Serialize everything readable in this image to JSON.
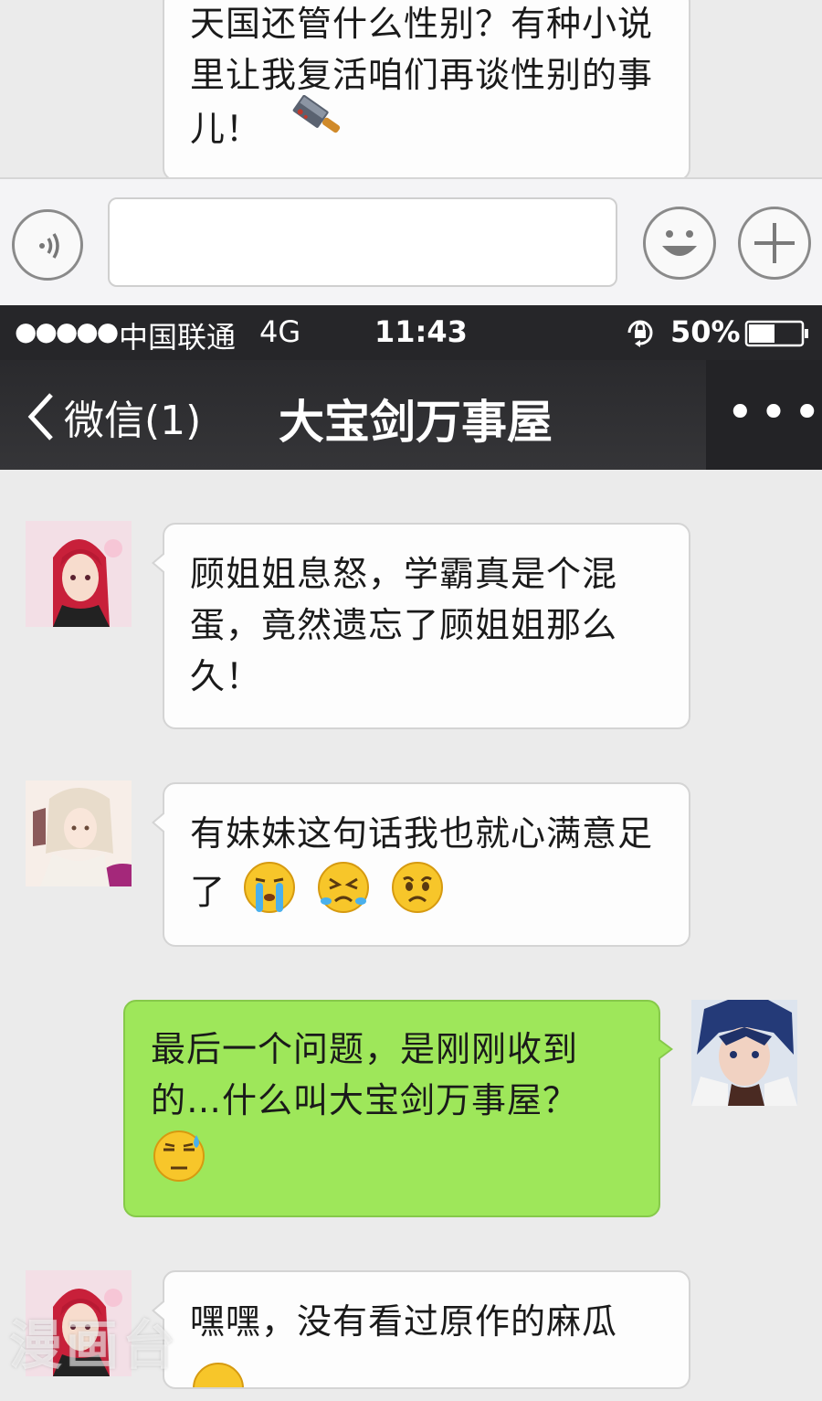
{
  "top_partial_message": {
    "lines": "天国还管什么性别？有种小说\n里让我复活咱们再谈性别的事\n儿！",
    "emoji": "knife-icon"
  },
  "input_bar": {
    "voice_icon": "voice-icon",
    "emoji_icon": "smile-icon",
    "plus_icon": "plus-icon",
    "text_value": ""
  },
  "status_bar": {
    "signal": "●●●●●",
    "carrier": "中国联通",
    "network": "4G",
    "time": "11:43",
    "battery": "50%",
    "battery_level": 0.5
  },
  "nav": {
    "back_label": "微信(1)",
    "title": "大宝剑万事屋",
    "more": "•••"
  },
  "messages": [
    {
      "side": "left",
      "avatar": "red-hair-girl-avatar",
      "text": "顾姐姐息怒，学霸真是个混\n蛋，竟然遗忘了顾姐姐那么\n久！",
      "emojis": []
    },
    {
      "side": "left",
      "avatar": "white-hair-lady-avatar",
      "text": "有妹妹这句话我也就心满意足\n了",
      "emojis": [
        "crying-face-icon",
        "angry-crying-face-icon",
        "sad-face-icon"
      ]
    },
    {
      "side": "right",
      "avatar": "blue-hair-boy-avatar",
      "text": "最后一个问题，是刚刚收到\n的…什么叫大宝剑万事屋？",
      "emojis": [
        "sweat-face-icon"
      ]
    },
    {
      "side": "left",
      "avatar": "red-hair-girl-avatar",
      "text": "嘿嘿，没有看过原作的麻瓜",
      "emojis": []
    }
  ],
  "watermark": "漫画台"
}
